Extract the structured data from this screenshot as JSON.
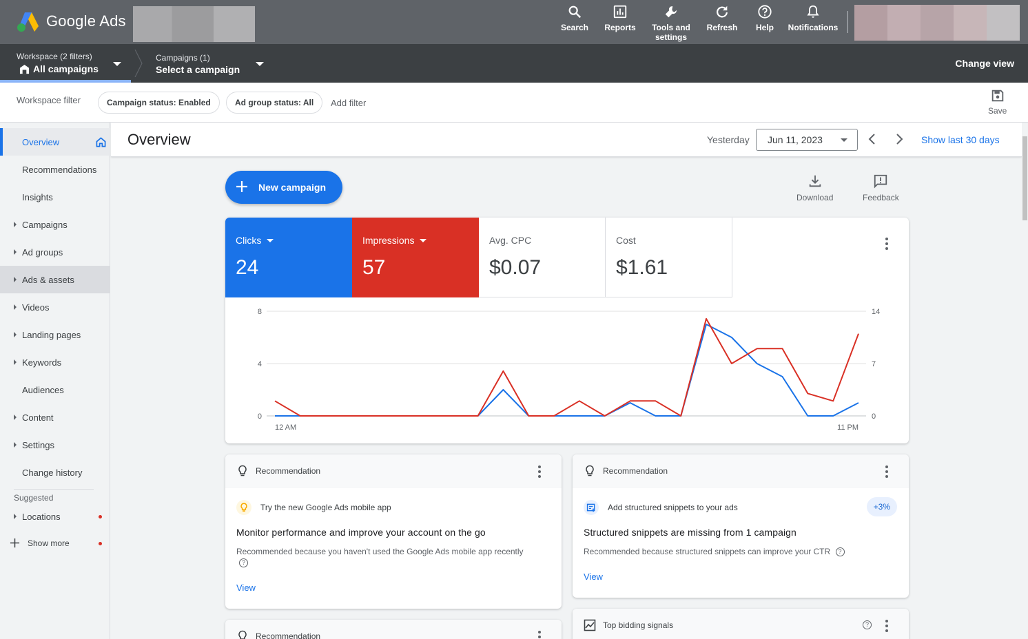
{
  "app": {
    "name": "Google Ads"
  },
  "topnav": {
    "items": [
      {
        "label": "Search",
        "icon": "search-icon"
      },
      {
        "label": "Reports",
        "icon": "reports-icon"
      },
      {
        "label": "Tools and settings",
        "icon": "wrench-icon"
      },
      {
        "label": "Refresh",
        "icon": "refresh-icon"
      },
      {
        "label": "Help",
        "icon": "help-icon"
      },
      {
        "label": "Notifications",
        "icon": "bell-icon"
      }
    ]
  },
  "workspace": {
    "small": "Workspace (2 filters)",
    "big": "All campaigns"
  },
  "campaigns": {
    "small": "Campaigns (1)",
    "big": "Select a campaign"
  },
  "change_view": "Change view",
  "filterbar": {
    "label": "Workspace filter",
    "chips": [
      "Campaign status: Enabled",
      "Ad group status: All"
    ],
    "add_filter": "Add filter",
    "save": "Save"
  },
  "sidebar": {
    "items": [
      {
        "label": "Overview",
        "active": true
      },
      {
        "label": "Recommendations"
      },
      {
        "label": "Insights"
      },
      {
        "label": "Campaigns",
        "expandable": true
      },
      {
        "label": "Ad groups",
        "expandable": true
      },
      {
        "label": "Ads & assets",
        "expandable": true
      },
      {
        "label": "Videos",
        "expandable": true
      },
      {
        "label": "Landing pages",
        "expandable": true
      },
      {
        "label": "Keywords",
        "expandable": true
      },
      {
        "label": "Audiences"
      },
      {
        "label": "Content",
        "expandable": true
      },
      {
        "label": "Settings",
        "expandable": true
      },
      {
        "label": "Change history"
      }
    ],
    "suggested_label": "Suggested",
    "suggested": [
      {
        "label": "Locations",
        "expandable": true
      }
    ],
    "show_more": "Show more"
  },
  "overview": {
    "title": "Overview",
    "date_label": "Yesterday",
    "date_value": "Jun 11, 2023",
    "show_last": "Show last 30 days"
  },
  "actions": {
    "new_campaign": "New campaign",
    "download": "Download",
    "feedback": "Feedback"
  },
  "metrics": [
    {
      "label": "Clicks",
      "value": "24",
      "color": "#1a73e8"
    },
    {
      "label": "Impressions",
      "value": "57",
      "color": "#d93025"
    },
    {
      "label": "Avg. CPC",
      "value": "$0.07"
    },
    {
      "label": "Cost",
      "value": "$1.61"
    }
  ],
  "chart_data": {
    "type": "line",
    "x": [
      "12 AM",
      "1",
      "2",
      "3",
      "4",
      "5",
      "6",
      "7",
      "8",
      "9",
      "10",
      "11",
      "12 PM",
      "1",
      "2",
      "3",
      "4",
      "5",
      "6",
      "7",
      "8",
      "9",
      "10",
      "11 PM"
    ],
    "xtick_labels": [
      "12 AM",
      "11 PM"
    ],
    "y_left": {
      "ticks": [
        "0",
        "4",
        "8"
      ],
      "lim": [
        0,
        8
      ]
    },
    "y_right": {
      "ticks": [
        "0",
        "7",
        "14"
      ],
      "lim": [
        0,
        14
      ]
    },
    "series": [
      {
        "axis": "left",
        "color": "#1a73e8",
        "values": [
          0,
          0,
          0,
          0,
          0,
          0,
          0,
          0,
          0,
          2,
          0,
          0,
          0,
          0,
          1,
          0,
          0,
          7,
          6,
          4,
          3,
          0,
          0,
          1
        ]
      },
      {
        "axis": "right",
        "color": "#d93025",
        "values": [
          2,
          0,
          0,
          0,
          0,
          0,
          0,
          0,
          0,
          6,
          0,
          0,
          2,
          0,
          2,
          2,
          0,
          13,
          7,
          9,
          9,
          3,
          2,
          11
        ]
      }
    ],
    "grid": true
  },
  "cards": [
    {
      "header": "Recommendation",
      "row_text": "Try the new Google Ads mobile app",
      "title": "Monitor performance and improve your account on the go",
      "desc": "Recommended because you haven't used the Google Ads mobile app recently",
      "link": "View"
    },
    {
      "header": "Recommendation",
      "row_text": "Add structured snippets to your ads",
      "badge": "+3%",
      "title": "Structured snippets are missing from 1 campaign",
      "desc": "Recommended because structured snippets can improve your CTR",
      "link": "View"
    },
    {
      "header": "Recommendation"
    },
    {
      "header": "Top bidding signals"
    }
  ]
}
